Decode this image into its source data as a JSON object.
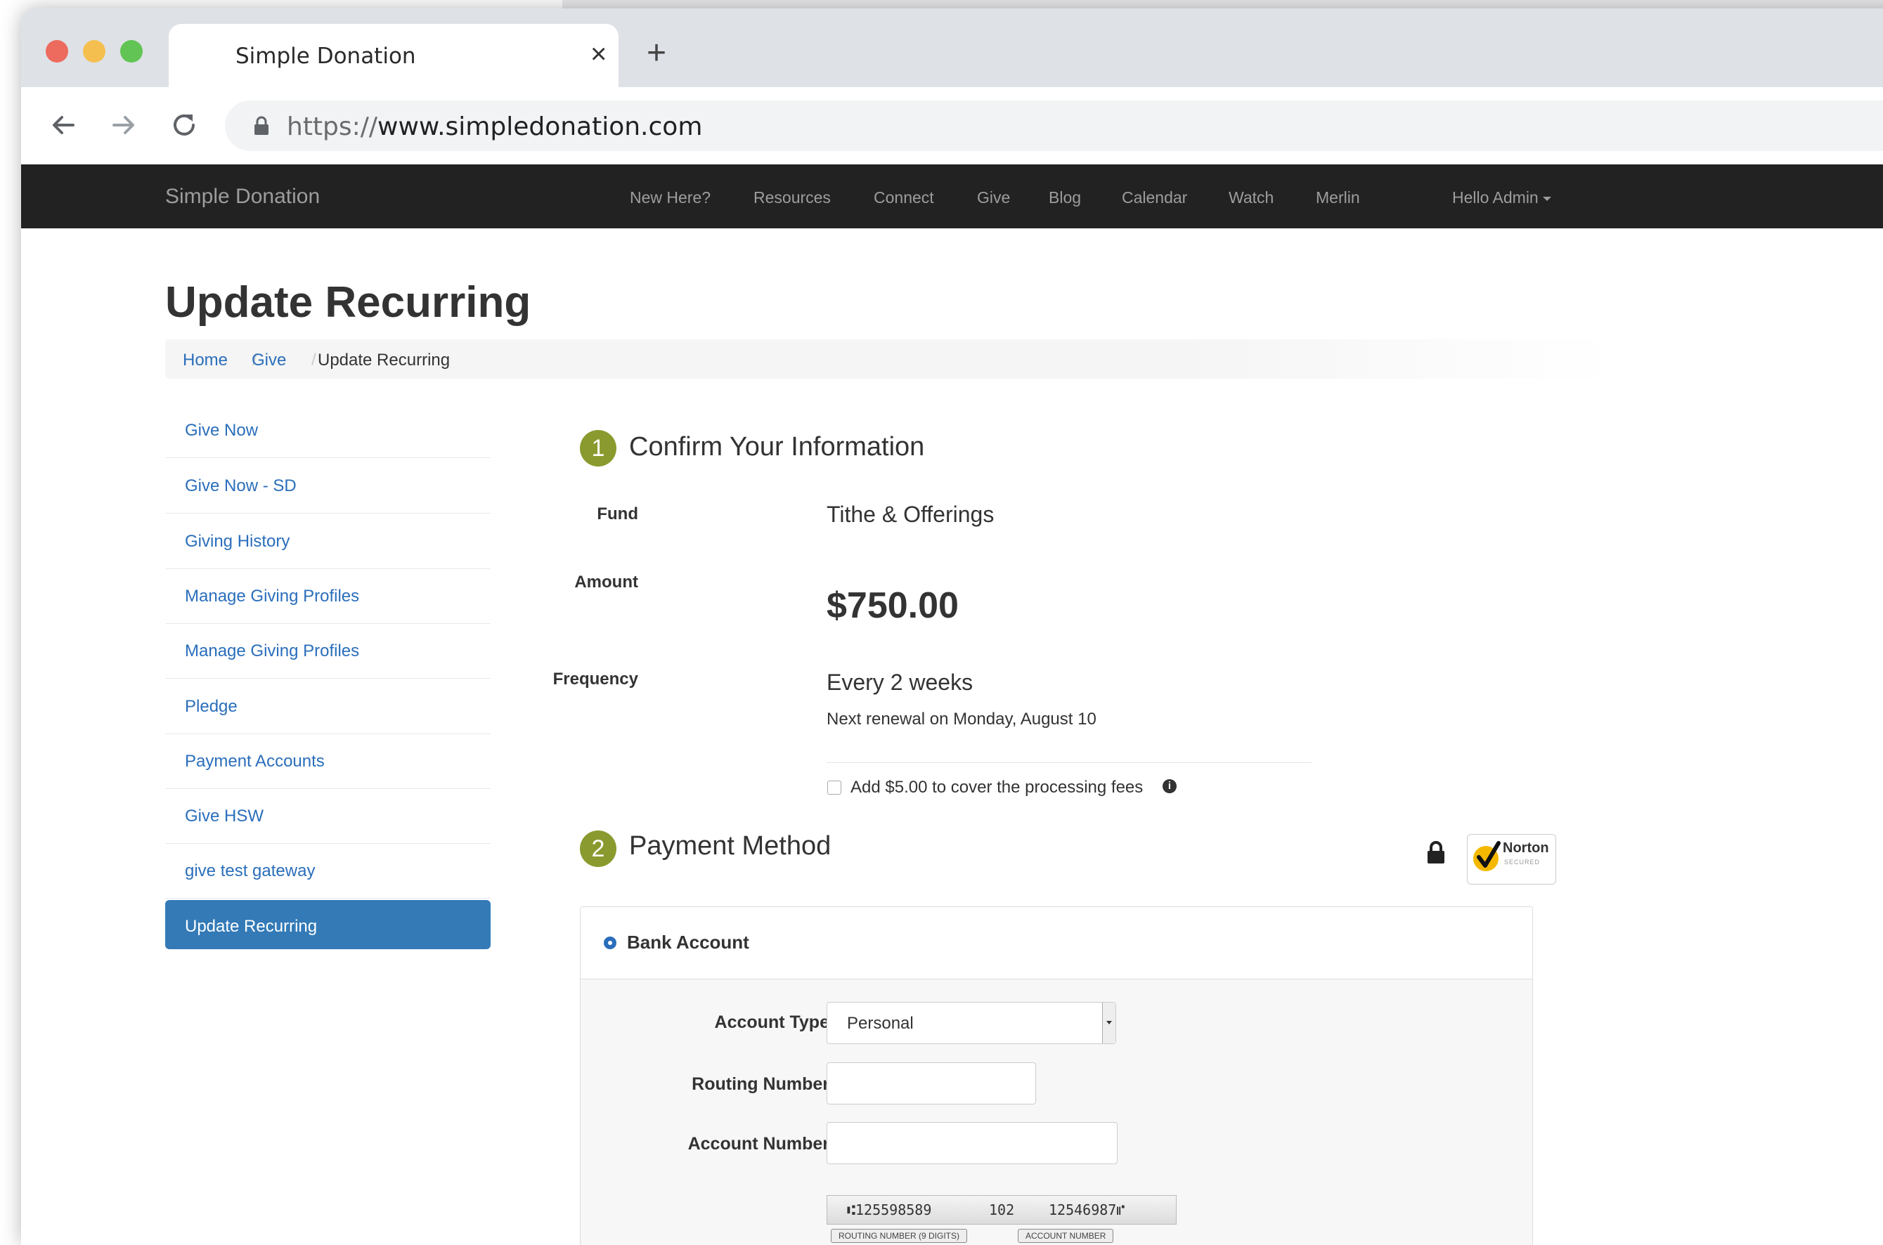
{
  "browser": {
    "tab_title": "Simple Donation",
    "url_scheme": "https://",
    "url_host": "www.simpledonation.com"
  },
  "navbar": {
    "brand": "Simple Donation",
    "links": [
      "New Here?",
      "Resources",
      "Connect",
      "Give",
      "Blog",
      "Calendar",
      "Watch",
      "Merlin"
    ],
    "user_menu": "Hello Admin"
  },
  "page": {
    "title": "Update Recurring",
    "breadcrumb": [
      "Home",
      "Give",
      "Update Recurring"
    ]
  },
  "sidebar": {
    "items": [
      {
        "label": "Give Now",
        "active": false
      },
      {
        "label": "Give Now - SD",
        "active": false
      },
      {
        "label": "Giving History",
        "active": false
      },
      {
        "label": "Manage Giving Profiles",
        "active": false
      },
      {
        "label": "Manage Giving Profiles",
        "active": false
      },
      {
        "label": "Pledge",
        "active": false
      },
      {
        "label": "Payment Accounts",
        "active": false
      },
      {
        "label": "Give HSW",
        "active": false
      },
      {
        "label": "give test gateway",
        "active": false
      },
      {
        "label": "Update Recurring",
        "active": true
      }
    ]
  },
  "confirm": {
    "step": "1",
    "title": "Confirm Your Information",
    "fund_label": "Fund",
    "fund_value": "Tithe & Offerings",
    "amount_label": "Amount",
    "amount_value": "$750.00",
    "frequency_label": "Frequency",
    "frequency_value": "Every 2 weeks",
    "next_renewal": "Next renewal on Monday, August 10",
    "fee_checkbox_label": "Add $5.00 to cover the processing fees",
    "fee_checked": false
  },
  "payment": {
    "step": "2",
    "title": "Payment Method",
    "method_label": "Bank Account",
    "account_type_label": "Account Type",
    "account_type_value": "Personal",
    "routing_label": "Routing Number",
    "routing_value": "",
    "account_label": "Account Number",
    "account_value": "",
    "check_routing_digits": "⑆125598589",
    "check_number_digits": "102",
    "check_account_digits": "12546987⑈",
    "check_routing_tag": "ROUTING NUMBER (9 DIGITS)",
    "check_account_tag": "ACCOUNT NUMBER"
  },
  "badge": {
    "name": "Norton",
    "sub": "SECURED"
  },
  "colors": {
    "navbar_bg": "#222222",
    "link": "#2a6ebb",
    "active_bg": "#337ab7",
    "step_badge": "#8a9a2e"
  }
}
